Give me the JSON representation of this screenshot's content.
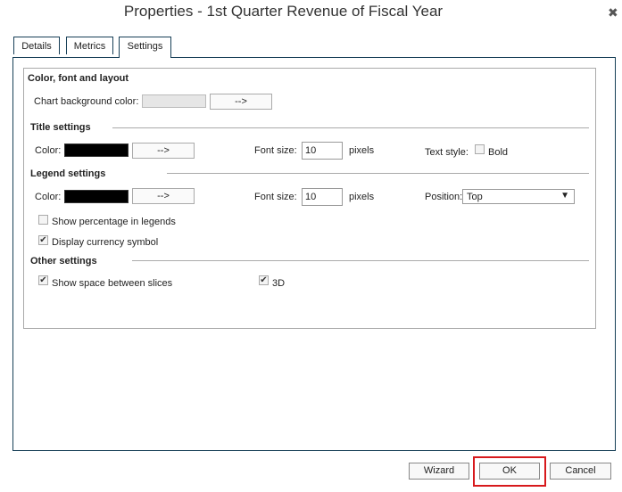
{
  "window": {
    "title": "Properties - 1st Quarter Revenue of Fiscal Year",
    "close_glyph": "✖"
  },
  "tabs": [
    {
      "label": "Details",
      "active": false
    },
    {
      "label": "Metrics",
      "active": false
    },
    {
      "label": "Settings",
      "active": true
    }
  ],
  "color_font_layout": {
    "heading": "Color, font and layout",
    "bg_label": "Chart background color:",
    "bg_color": "#e6e6e6",
    "picker_label": "-->"
  },
  "title_settings": {
    "heading": "Title settings",
    "color_label": "Color:",
    "color": "#000000",
    "picker_label": "-->",
    "font_size_label": "Font size:",
    "font_size": "10",
    "units": "pixels",
    "text_style_label": "Text style:",
    "bold_label": "Bold",
    "bold_checked": false
  },
  "legend_settings": {
    "heading": "Legend settings",
    "color_label": "Color:",
    "color": "#000000",
    "picker_label": "-->",
    "font_size_label": "Font size:",
    "font_size": "10",
    "units": "pixels",
    "position_label": "Position:",
    "position_value": "Top",
    "show_percentage_label": "Show percentage in legends",
    "show_percentage_checked": false,
    "currency_label": "Display currency symbol",
    "currency_checked": true
  },
  "other_settings": {
    "heading": "Other settings",
    "space_label": "Show space between slices",
    "space_checked": true,
    "three_d_label": "3D",
    "three_d_checked": true
  },
  "footer": {
    "wizard": "Wizard",
    "ok": "OK",
    "cancel": "Cancel"
  },
  "colors": {
    "accent_border": "#173f57",
    "highlight": "#d7191c"
  }
}
